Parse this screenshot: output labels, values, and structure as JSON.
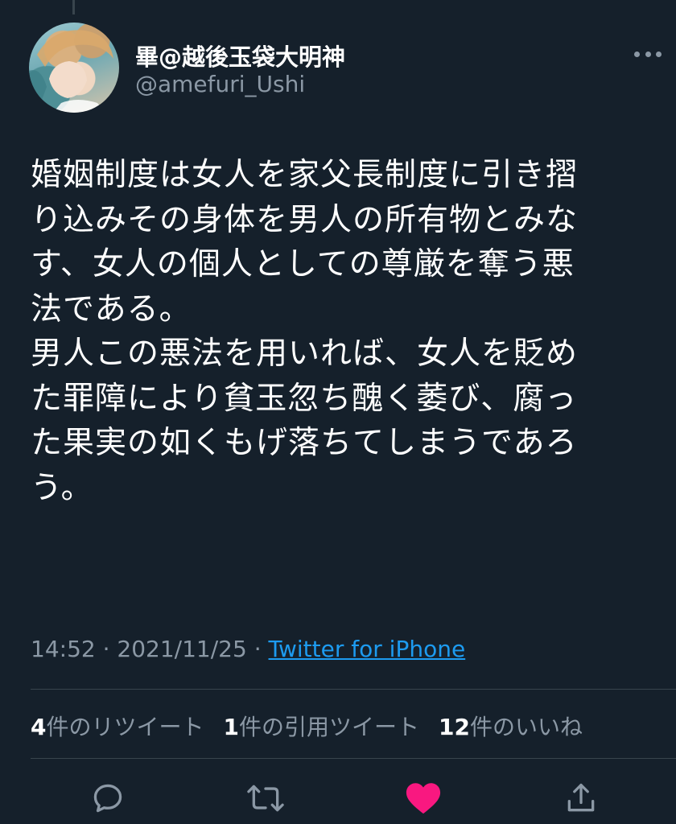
{
  "user": {
    "display_name": "畢@越後玉袋大明神",
    "handle": "@amefuri_Ushi"
  },
  "tweet": {
    "lines": [
      "婚姻制度は女人を家父長制度に引き摺",
      "り込みその身体を男人の所有物とみな",
      "す、女人の個人としての尊厳を奪う悪",
      "法である。",
      "男人この悪法を用いれば、女人を貶め",
      "た罪障により貧玉忽ち醜く萎び、腐っ",
      "た果実の如くもげ落ちてしまうであろ",
      "う。"
    ]
  },
  "meta": {
    "time": "14:52",
    "separator": "·",
    "date": "2021/11/25",
    "source": "Twitter for iPhone"
  },
  "stats": {
    "retweets_count": "4",
    "retweets_label": "件のリツイート",
    "quotes_count": "1",
    "quotes_label": "件の引用ツイート",
    "likes_count": "12",
    "likes_label": "件のいいね"
  },
  "actions": {
    "icons": [
      "reply-icon",
      "retweet-icon",
      "like-icon",
      "share-icon"
    ],
    "like_color": "#f91880",
    "icon_color": "#8b98a5"
  },
  "colors": {
    "background": "#15202b",
    "link": "#1d9bf0",
    "secondary_text": "#8b98a5"
  }
}
